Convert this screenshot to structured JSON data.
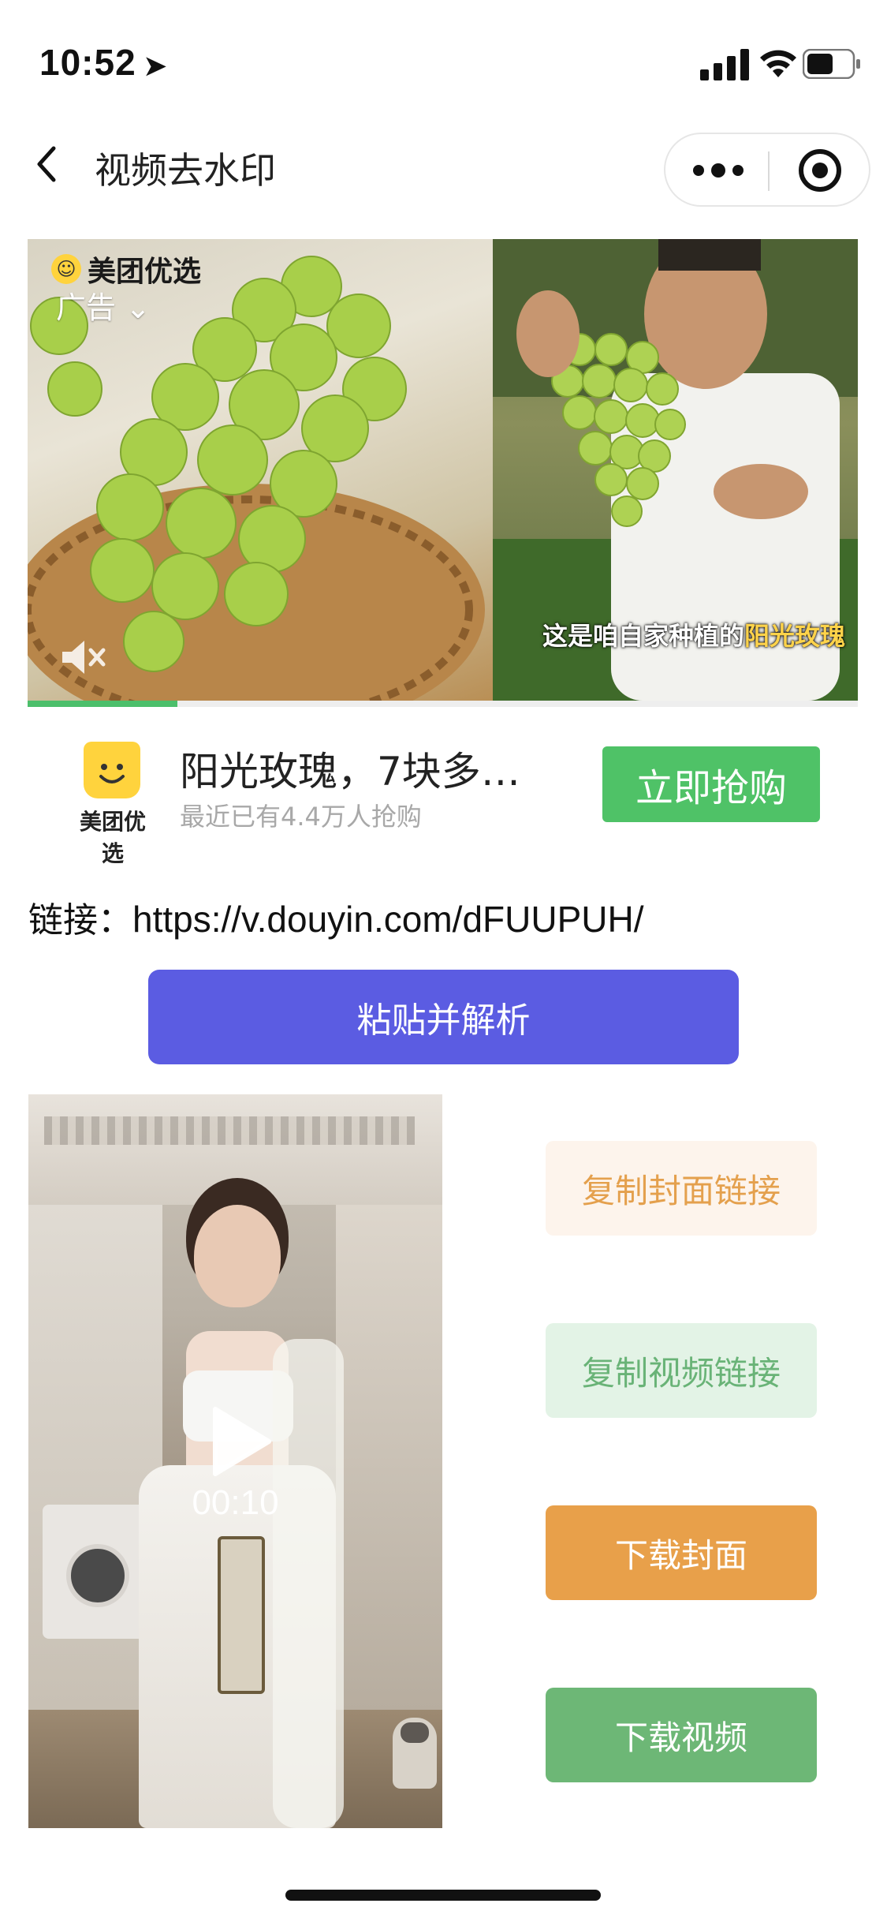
{
  "status_bar": {
    "time": "10:52",
    "location_icon": "location-arrow-icon",
    "signal_icon": "cellular-signal-icon",
    "wifi_icon": "wifi-icon",
    "battery_icon": "battery-icon"
  },
  "nav": {
    "title": "视频去水印",
    "back_icon": "chevron-left-icon",
    "more_icon": "more-dots-icon",
    "close_icon": "target-circle-icon"
  },
  "ad": {
    "brand": "美团优选",
    "label": "广告",
    "caption_prefix": "这是咱自家种植的",
    "caption_highlight": "阳光玫瑰",
    "progress": 0.18,
    "headline": "阳光玫瑰，7块多买…",
    "subtext": "最近已有4.4万人抢购",
    "logo_text": "美团优选",
    "cta": "立即抢购"
  },
  "link": {
    "label": "链接：",
    "url": "https://v.douyin.com/dFUUPUH/"
  },
  "paste_button": "粘贴并解析",
  "video": {
    "duration": "00:10"
  },
  "actions": {
    "copy_cover_link": "复制封面链接",
    "copy_video_link": "复制视频链接",
    "download_cover": "下载封面",
    "download_video": "下载视频"
  },
  "colors": {
    "primary": "#5b5ce2",
    "green_cta": "#4fc267",
    "orange": "#e8a04a",
    "green": "#6db776"
  }
}
